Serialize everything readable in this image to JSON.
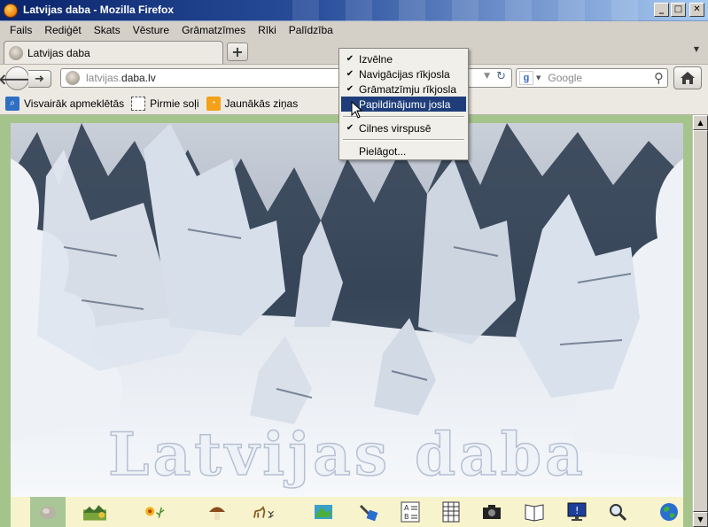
{
  "window": {
    "title": "Latvijas daba - Mozilla Firefox",
    "controls": {
      "minimize": "_",
      "maximize": "□",
      "close": "✕"
    }
  },
  "menubar": [
    {
      "label": "Fails"
    },
    {
      "label": "Rediģēt"
    },
    {
      "label": "Skats"
    },
    {
      "label": "Vēsture"
    },
    {
      "label": "Grāmatzīmes"
    },
    {
      "label": "Rīki"
    },
    {
      "label": "Palīdzība"
    }
  ],
  "tabs": [
    {
      "label": "Latvijas daba",
      "active": true
    }
  ],
  "new_tab_label": "+",
  "navbar": {
    "url_prefix": "latvijas.",
    "url_domain": "daba.lv",
    "search_engine_letter": "g",
    "search_placeholder": "Google"
  },
  "bookmarks": [
    {
      "label": "Visvairāk apmeklētās",
      "icon": "search-icon"
    },
    {
      "label": "Pirmie soļi",
      "icon": "dashed-page-icon"
    },
    {
      "label": "Jaunākās ziņas",
      "icon": "rss-icon"
    }
  ],
  "context_menu": {
    "items": [
      {
        "label": "Izvēlne",
        "checked": true,
        "highlighted": false
      },
      {
        "label": "Navigācijas rīkjosla",
        "checked": true,
        "highlighted": false
      },
      {
        "label": "Grāmatzīmju rīkjosla",
        "checked": true,
        "highlighted": false
      },
      {
        "label": "Papildinājumu josla",
        "checked": false,
        "highlighted": true
      },
      {
        "label": "Cilnes virspusē",
        "checked": true,
        "highlighted": false
      },
      {
        "label": "Pielāgot...",
        "checked": false,
        "highlighted": false
      }
    ]
  },
  "page": {
    "watermark": "Latvijas daba",
    "iconbar": [
      "stone-icon",
      "landscape-icon",
      "flowers-icon",
      "mushroom-icon",
      "animals-icon",
      "map-icon",
      "tools-icon",
      "alphabet-icon",
      "table-icon",
      "camera-icon",
      "book-icon",
      "monitor-icon",
      "magnifier-icon",
      "globe-icon"
    ]
  },
  "colors": {
    "title_gradient_start": "#0a246a",
    "menu_highlight": "#1f3d7a",
    "content_border": "#a4c48c",
    "iconbar_bg": "#f7f3cc"
  }
}
